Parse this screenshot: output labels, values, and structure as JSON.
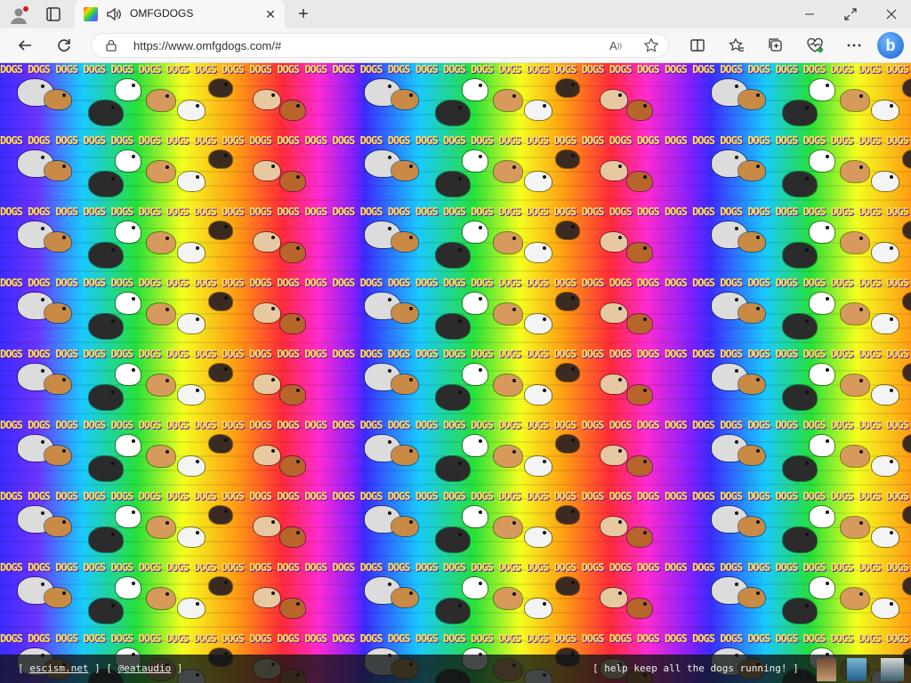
{
  "browser": {
    "tab": {
      "title": "OMFGDOGS",
      "audio_icon": "speaker-icon",
      "close_label": "✕"
    },
    "new_tab_label": "+",
    "address": {
      "url": "https://www.omfgdogs.com/#"
    },
    "icons": [
      "profile-icon",
      "tab-actions-icon",
      "back-icon",
      "refresh-icon",
      "lock-icon",
      "read-aloud-icon",
      "favorite-star-icon",
      "split-screen-icon",
      "favorites-icon",
      "collections-icon",
      "browser-essentials-icon",
      "more-icon",
      "bing-icon"
    ]
  },
  "page": {
    "background_word": "DOGS",
    "colors": [
      "#3b2bff",
      "#19c9ff",
      "#26e03a",
      "#f3ff1f",
      "#ff9b13",
      "#ff2a3a",
      "#ff2ad1",
      "#7d20ff"
    ]
  },
  "footer": {
    "left_open": "[",
    "link1": "escism.net",
    "mid": "] [",
    "link2": "@eataudio",
    "left_close": "]",
    "right_text": "[ help keep all the dogs running! ]"
  }
}
